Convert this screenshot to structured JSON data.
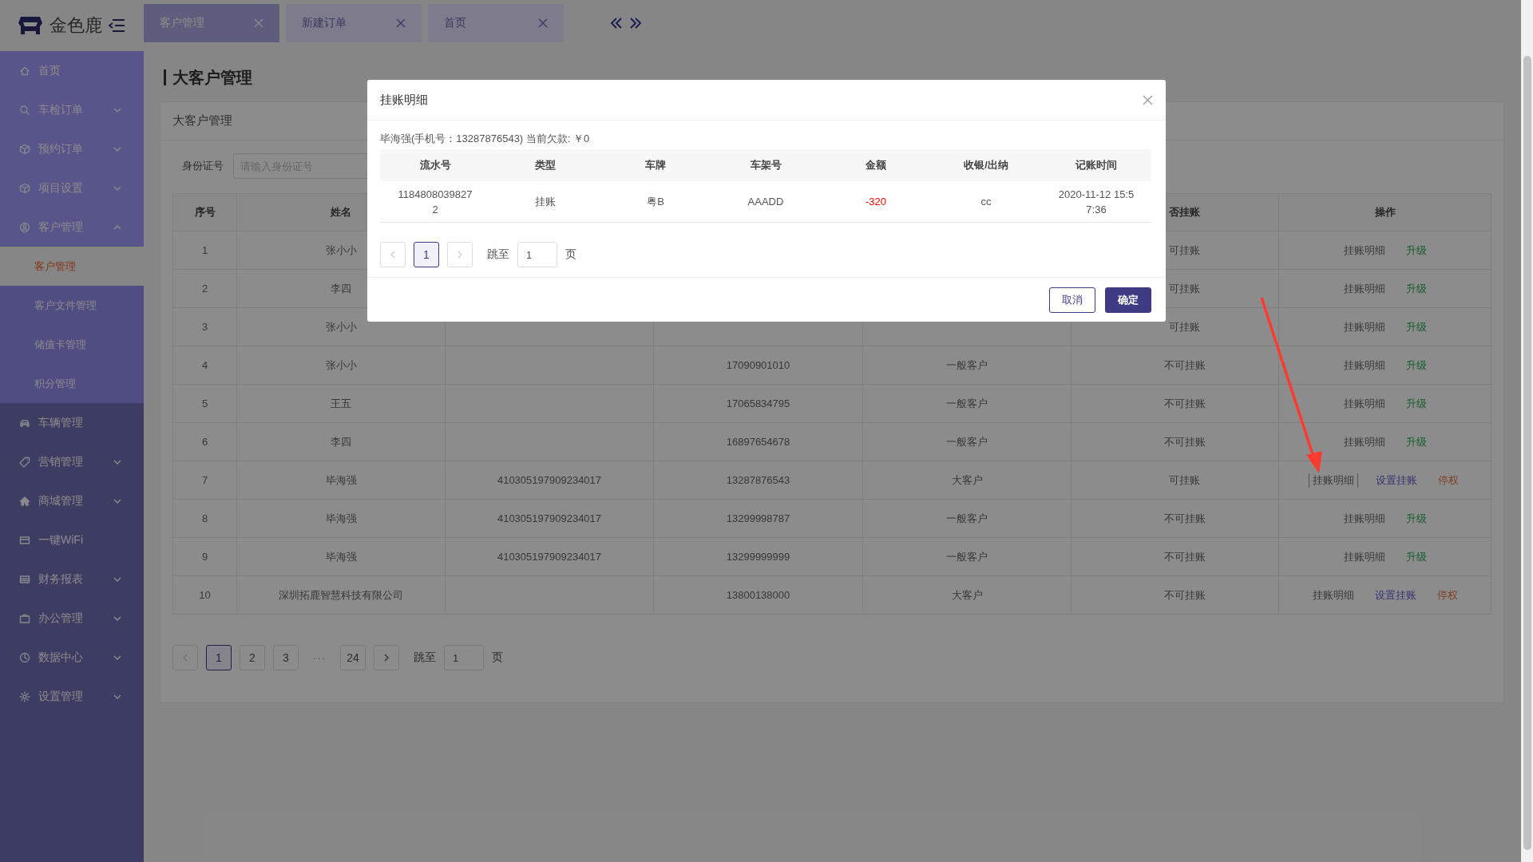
{
  "logo": {
    "text": "金色鹿"
  },
  "tabs": [
    {
      "label": "客户管理",
      "selected": true
    },
    {
      "label": "新建订单",
      "selected": false
    },
    {
      "label": "首页",
      "selected": false
    }
  ],
  "sidebar": {
    "items": [
      {
        "label": "首页",
        "highlighted": true
      },
      {
        "label": "车检订单",
        "expanded": false,
        "highlighted": true
      },
      {
        "label": "预约订单",
        "expanded": false,
        "highlighted": true
      },
      {
        "label": "项目设置",
        "expanded": false,
        "highlighted": true
      },
      {
        "label": "客户管理",
        "expanded": true,
        "highlighted": true,
        "children": [
          {
            "label": "客户管理",
            "selected": true
          },
          {
            "label": "客户文件管理",
            "selected": false
          },
          {
            "label": "储值卡管理",
            "selected": false
          },
          {
            "label": "积分管理",
            "selected": false
          }
        ]
      },
      {
        "label": "车辆管理",
        "highlighted": false
      },
      {
        "label": "营销管理",
        "expanded": false,
        "highlighted": false
      },
      {
        "label": "商城管理",
        "expanded": false,
        "highlighted": false
      },
      {
        "label": "一键WiFi",
        "highlighted": false
      },
      {
        "label": "财务报表",
        "expanded": false,
        "highlighted": false
      },
      {
        "label": "办公管理",
        "expanded": false,
        "highlighted": false
      },
      {
        "label": "数据中心",
        "expanded": false,
        "highlighted": false
      },
      {
        "label": "设置管理",
        "expanded": false,
        "highlighted": false
      }
    ]
  },
  "page_title": "大客户管理",
  "card": {
    "title": "大客户管理",
    "search": {
      "label": "身份证号",
      "placeholder": "请输入身份证号"
    },
    "table": {
      "header": {
        "index": "序号",
        "name": "姓名",
        "column_6": "否挂账",
        "actions": "操作"
      },
      "rows": [
        {
          "index": "1",
          "name": "张小小",
          "status": "可挂账",
          "actions": [
            {
              "kind": "detail",
              "label": "挂账明细",
              "focused": false
            },
            {
              "kind": "upgrade",
              "label": "升级"
            }
          ]
        },
        {
          "index": "2",
          "name": "李四",
          "status": "可挂账",
          "actions": [
            {
              "kind": "detail",
              "label": "挂账明细",
              "focused": false
            },
            {
              "kind": "upgrade",
              "label": "升级"
            }
          ]
        },
        {
          "index": "3",
          "name": "张小小",
          "status": "可挂账",
          "actions": [
            {
              "kind": "detail",
              "label": "挂账明细",
              "focused": false
            },
            {
              "kind": "upgrade",
              "label": "升级"
            }
          ]
        },
        {
          "index": "4",
          "name": "张小小",
          "phone": "17090901010",
          "customer_type": "一般客户",
          "status": "不可挂账",
          "actions": [
            {
              "kind": "detail",
              "label": "挂账明细",
              "focused": false
            },
            {
              "kind": "upgrade",
              "label": "升级"
            }
          ]
        },
        {
          "index": "5",
          "name": "王五",
          "phone": "17065834795",
          "customer_type": "一般客户",
          "status": "不可挂账",
          "actions": [
            {
              "kind": "detail",
              "label": "挂账明细",
              "focused": false
            },
            {
              "kind": "upgrade",
              "label": "升级"
            }
          ]
        },
        {
          "index": "6",
          "name": "李四",
          "phone": "16897654678",
          "customer_type": "一般客户",
          "status": "不可挂账",
          "actions": [
            {
              "kind": "detail",
              "label": "挂账明细",
              "focused": false
            },
            {
              "kind": "upgrade",
              "label": "升级"
            }
          ]
        },
        {
          "index": "7",
          "name": "毕海强",
          "id_number": "410305197909234017",
          "phone": "13287876543",
          "customer_type": "大客户",
          "status": "可挂账",
          "actions": [
            {
              "kind": "detail",
              "label": "挂账明细",
              "focused": true
            },
            {
              "kind": "set",
              "label": "设置挂账"
            },
            {
              "kind": "suspend",
              "label": "停权"
            }
          ]
        },
        {
          "index": "8",
          "name": "毕海强",
          "id_number": "410305197909234017",
          "phone": "13299998787",
          "customer_type": "一般客户",
          "status": "不可挂账",
          "actions": [
            {
              "kind": "detail",
              "label": "挂账明细",
              "focused": false
            },
            {
              "kind": "upgrade",
              "label": "升级"
            }
          ]
        },
        {
          "index": "9",
          "name": "毕海强",
          "id_number": "410305197909234017",
          "phone": "13299999999",
          "customer_type": "一般客户",
          "status": "不可挂账",
          "actions": [
            {
              "kind": "detail",
              "label": "挂账明细",
              "focused": false
            },
            {
              "kind": "upgrade",
              "label": "升级"
            }
          ]
        },
        {
          "index": "10",
          "name": "深圳拓鹿智慧科技有限公司",
          "phone": "13800138000",
          "customer_type": "大客户",
          "status": "不可挂账",
          "actions": [
            {
              "kind": "detail",
              "label": "挂账明细",
              "focused": false
            },
            {
              "kind": "set",
              "label": "设置挂账"
            },
            {
              "kind": "suspend",
              "label": "停权"
            }
          ]
        }
      ]
    },
    "pager": {
      "prev_disabled": true,
      "next_disabled": false,
      "pages": [
        {
          "kind": "page",
          "label": "1",
          "selected": true
        },
        {
          "kind": "page",
          "label": "2",
          "selected": false
        },
        {
          "kind": "page",
          "label": "3",
          "selected": false
        },
        {
          "kind": "ellipsis",
          "label": "···"
        },
        {
          "kind": "page",
          "label": "24",
          "selected": false
        }
      ],
      "jump_label": "跳至",
      "jump_value": "1",
      "page_unit": "页"
    }
  },
  "dialog": {
    "title": "挂账明细",
    "summary": "毕海强(手机号：13287876543) 当前欠款: ￥0",
    "columns": [
      "流水号",
      "类型",
      "车牌",
      "车架号",
      "金额",
      "收银/出纳",
      "记账时间"
    ],
    "rows": [
      {
        "cells": [
          "11848080398272",
          "挂账",
          "粤B",
          "AAADD",
          "-320",
          "cc",
          "2020-11-12 15:57:36"
        ]
      }
    ],
    "pager": {
      "prev_disabled": true,
      "next_disabled": true,
      "pages": [
        {
          "kind": "page",
          "label": "1",
          "selected": true
        }
      ],
      "jump_label": "跳至",
      "jump_value": "1",
      "page_unit": "页"
    },
    "buttons": [
      {
        "kind": "secondary",
        "label": "取消"
      },
      {
        "kind": "primary",
        "label": "确定"
      }
    ]
  }
}
